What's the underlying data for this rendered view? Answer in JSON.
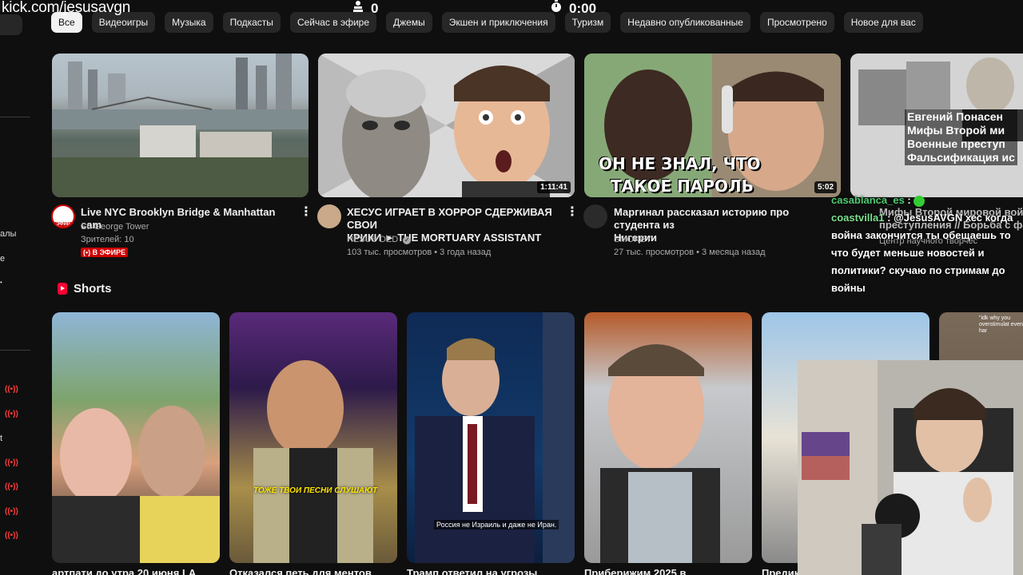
{
  "overlay": {
    "kick_url": "kick.com/jesusavgn",
    "viewers": "0",
    "timer": "0:00"
  },
  "sidebar": {
    "fragments": [
      "алы",
      "е",
      "t"
    ]
  },
  "chips": [
    "Все",
    "Видеоигры",
    "Музыка",
    "Подкасты",
    "Сейчас в эфире",
    "Джемы",
    "Экшен и приключения",
    "Туризм",
    "Недавно опубликованные",
    "Просмотрено",
    "Новое для вас"
  ],
  "videos": [
    {
      "title": "Live NYC Brooklyn Bridge & Manhattan cam",
      "channel": "St. George Tower",
      "meta": "Зрителей: 10",
      "live_badge": "(•) В ЭФИРЕ",
      "avatar_badge": "ЭФИР"
    },
    {
      "title_line1": "ХЕСУС ИГРАЕТ В ХОРРОР СДЕРЖИВАЯ СВОИ",
      "title_line2": "КРИКИ ► THE MORTUARY ASSISTANT",
      "channel": "HESUS DED",
      "meta": "103 тыс. просмотров • 3 года назад",
      "duration": "1:11:41"
    },
    {
      "title_line1": "Маргинал рассказал историю про студента из",
      "title_line2": "Нигерии",
      "channel": "SMOKEY",
      "meta": "27 тыс. просмотров • 3 месяца назад",
      "duration": "5:02",
      "thumb_text_line1": "ОН НЕ ЗНАЛ, ЧТО",
      "thumb_text_line2": "ТАКОЕ ПАРОЛЬ"
    },
    {
      "thumb_text_line1": "Евгений Понасен",
      "thumb_text_line2": "Мифы Второй ми",
      "thumb_text_line3": "Военные преступ",
      "thumb_text_line4": "Фальсификация ис",
      "title_partial": "Мифы Второй мировой войны",
      "title_partial2": "преступления // Борьба с фальс",
      "meta_partial": "Центр научного творчес"
    }
  ],
  "shorts": {
    "heading": "Shorts",
    "items": [
      {
        "title": "артпати до утра 20 июня LA"
      },
      {
        "title": "Отказался петь для ментов",
        "caption": "ТОЖЕ ТВОИ ПЕСНИ СЛУШАЮТ"
      },
      {
        "title": "Трамп ответил на угрозы",
        "caption": "Россия не Израиль и даже не Иран."
      },
      {
        "title": "Приберижим 2025 в"
      },
      {
        "title": "Предик"
      },
      {
        "title": "",
        "caption": "\"idk why you overstimulat even har"
      }
    ]
  },
  "chat": [
    {
      "user": "casablanca_es",
      "text": ""
    },
    {
      "user": "coastvilla1",
      "text": "@JesusAVGN хес когда война закончится ты обещаешь то что будет меньше новостей и политики? скучаю по стримам до войны"
    }
  ],
  "colors": {
    "background": "#0f0f0f",
    "chip": "#272727",
    "live_red": "#cc0000",
    "chat_green": "#4ecb71"
  }
}
